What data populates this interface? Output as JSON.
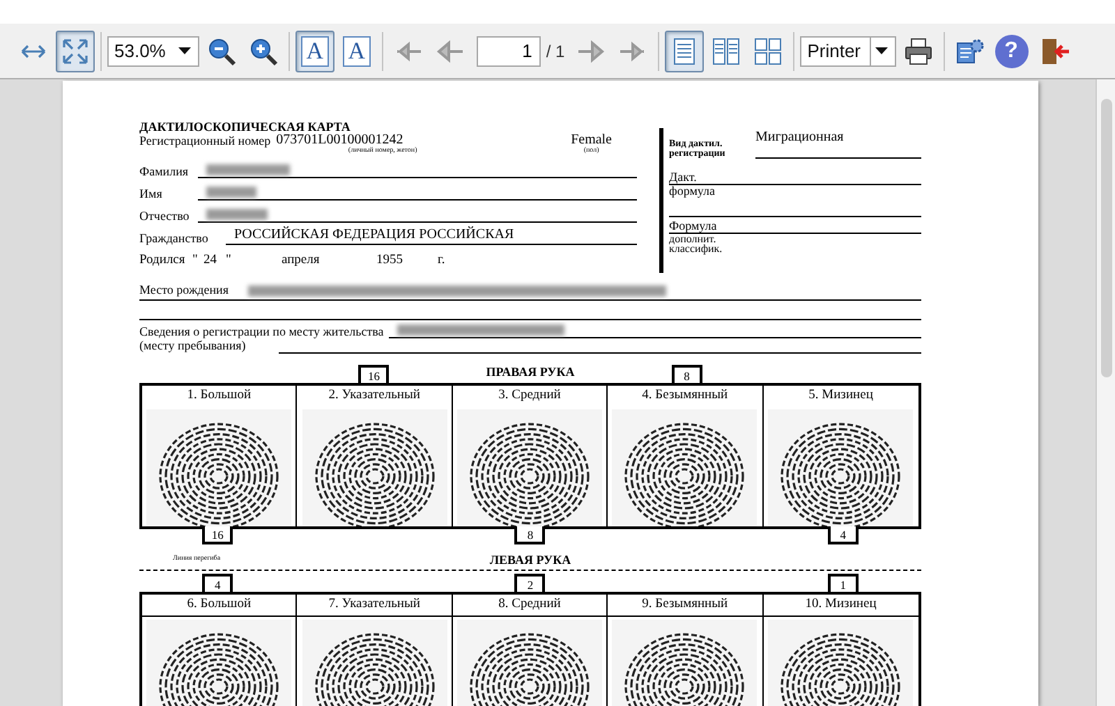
{
  "toolbar": {
    "items": [
      {
        "kind": "fit-width",
        "selected": false
      },
      {
        "kind": "fit-page",
        "selected": true
      },
      {
        "kind": "separator"
      },
      {
        "kind": "zoom-select",
        "value": "53.0%"
      },
      {
        "kind": "zoom-out",
        "selected": false
      },
      {
        "kind": "zoom-in",
        "selected": false
      },
      {
        "kind": "separator"
      },
      {
        "kind": "text-select",
        "glyph": "A",
        "selected": true
      },
      {
        "kind": "text-annotate",
        "glyph": "A",
        "selected": false
      },
      {
        "kind": "separator"
      },
      {
        "kind": "first-page",
        "selected": false
      },
      {
        "kind": "prev-page",
        "selected": false
      },
      {
        "kind": "page-field",
        "value": "1",
        "total": "/ 1"
      },
      {
        "kind": "next-page",
        "selected": false
      },
      {
        "kind": "last-page",
        "selected": false
      },
      {
        "kind": "separator"
      },
      {
        "kind": "single-page",
        "selected": true
      },
      {
        "kind": "two-page",
        "selected": false
      },
      {
        "kind": "grid-page",
        "selected": false
      },
      {
        "kind": "separator"
      },
      {
        "kind": "printer-select",
        "value": "Printer"
      },
      {
        "kind": "print",
        "selected": false
      },
      {
        "kind": "separator"
      },
      {
        "kind": "settings",
        "selected": false
      },
      {
        "kind": "help",
        "glyph": "?",
        "selected": false
      },
      {
        "kind": "exit",
        "selected": false
      }
    ]
  },
  "card": {
    "title": "ДАКТИЛОСКОПИЧЕСКАЯ КАРТА",
    "reg_label": "Регистрационный номер",
    "reg_number": "073701L00100001242",
    "reg_note": "(личный номер, жетон)",
    "sex": "Female",
    "sex_note": "(пол)",
    "fields": [
      {
        "label": "Фамилия"
      },
      {
        "label": "Имя"
      },
      {
        "label": "Отчество"
      },
      {
        "label": "Гражданство",
        "value": "РОССИЙСКАЯ ФЕДЕРАЦИЯ РОССИЙСКАЯ"
      }
    ],
    "birth": {
      "label": "Родился",
      "quote_open": "\"",
      "day": "24",
      "quote_close": "\"",
      "month": "апреля",
      "year": "1955",
      "year_suffix": "г."
    },
    "birthplace": {
      "label": "Место рождения"
    },
    "residence": {
      "label": "Сведения о регистрации по месту жительства",
      "label_2": "(месту пребывания)"
    },
    "side_panel": {
      "type_label": "Вид дактил. регистрации",
      "type_value": "Миграционная",
      "formula_label": "Дакт.",
      "formula_label_2": "формула",
      "extra_label": "Формула",
      "extra_label_2": "дополнит.",
      "extra_label_3": "классифик."
    },
    "right_hand": {
      "title": "ПРАВАЯ РУКА",
      "fingers": [
        {
          "label": "1. Большой",
          "bottom_count": "16"
        },
        {
          "label": "2. Указательный",
          "top_count": "16"
        },
        {
          "label": "3. Средний",
          "bottom_count": "8"
        },
        {
          "label": "4. Безымянный",
          "top_count": "8"
        },
        {
          "label": "5. Мизинец",
          "bottom_count": "4"
        }
      ]
    },
    "fold_line_label": "Линия перегиба",
    "left_hand": {
      "title": "ЛЕВАЯ РУКА",
      "fingers": [
        {
          "label": "6. Большой",
          "top_count": "4"
        },
        {
          "label": "7. Указательный"
        },
        {
          "label": "8. Средний",
          "top_count": "2"
        },
        {
          "label": "9. Безымянный"
        },
        {
          "label": "10. Мизинец",
          "top_count": "1"
        }
      ]
    }
  }
}
